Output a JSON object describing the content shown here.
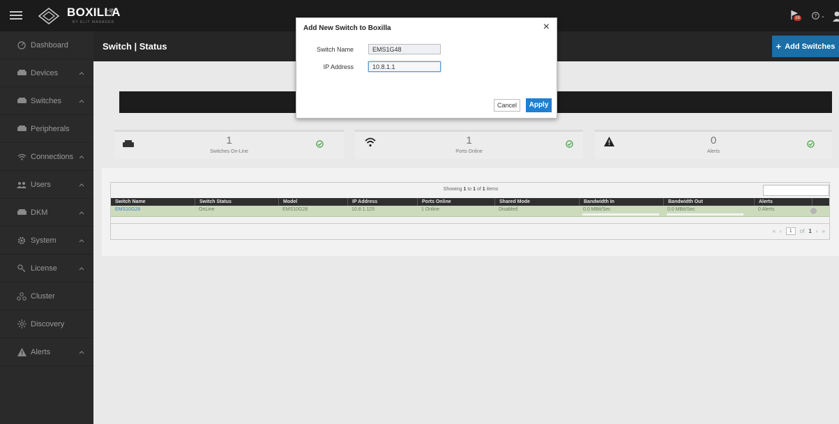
{
  "app": {
    "brand": "BOXILLA",
    "brand_sub": "BY ELIT MANAGER",
    "notification_count": "16",
    "help_label": "?"
  },
  "sidebar": {
    "items": [
      {
        "label": "Dashboard",
        "icon": "dashboard-icon",
        "expandable": false
      },
      {
        "label": "Devices",
        "icon": "devices-icon",
        "expandable": true
      },
      {
        "label": "Switches",
        "icon": "switches-icon",
        "expandable": true
      },
      {
        "label": "Peripherals",
        "icon": "peripherals-icon",
        "expandable": false
      },
      {
        "label": "Connections",
        "icon": "connections-icon",
        "expandable": true
      },
      {
        "label": "Users",
        "icon": "users-icon",
        "expandable": true
      },
      {
        "label": "DKM",
        "icon": "dkm-icon",
        "expandable": true
      },
      {
        "label": "System",
        "icon": "gear-icon",
        "expandable": true
      },
      {
        "label": "License",
        "icon": "key-icon",
        "expandable": true
      },
      {
        "label": "Cluster",
        "icon": "cluster-icon",
        "expandable": false
      },
      {
        "label": "Discovery",
        "icon": "discovery-icon",
        "expandable": false
      },
      {
        "label": "Alerts",
        "icon": "alert-icon",
        "expandable": true
      }
    ]
  },
  "header": {
    "title": "Switch | Status",
    "add_button": "Add Switches"
  },
  "stats": [
    {
      "value": "1",
      "label": "Switches On-Line"
    },
    {
      "value": "1",
      "label": "Ports Online"
    },
    {
      "value": "0",
      "label": "Alerts"
    }
  ],
  "table": {
    "showing_prefix": "Showing ",
    "showing_from": "1",
    "showing_mid": " to ",
    "showing_to": "1",
    "showing_of": " of ",
    "showing_total": "1",
    "showing_suffix": " items",
    "columns": [
      "Switch Name",
      "Switch Status",
      "Model",
      "IP Address",
      "Ports Online",
      "Shared Mode",
      "Bandwidth In",
      "Bandwidth Out",
      "Alerts"
    ],
    "rows": [
      {
        "switch_name": "EMS10G28",
        "status": "OnLine",
        "model": "EMS10G28",
        "ip": "10.8.1.125",
        "ports": "1 Online",
        "shared": "Disabled",
        "bw_in": "0.0 MBit/Sec",
        "bw_out": "0.0 MBit/Sec",
        "alerts": "0 Alerts"
      }
    ],
    "pager": {
      "first": "«",
      "prev": "‹",
      "page": "1",
      "of": "of",
      "total_pages": "1",
      "next": "›",
      "last": "»"
    }
  },
  "modal": {
    "title": "Add New Switch to Boxilla",
    "close": "×",
    "fields": [
      {
        "label": "Switch Name",
        "value": "EMS1G48"
      },
      {
        "label": "IP Address",
        "value": "10.8.1.1"
      }
    ],
    "cancel": "Cancel",
    "apply": "Apply"
  },
  "colors": {
    "accent": "#1b6ea6",
    "apply": "#1f7fd1",
    "row_highlight": "#cddbbd",
    "success": "#3c9a3c"
  }
}
